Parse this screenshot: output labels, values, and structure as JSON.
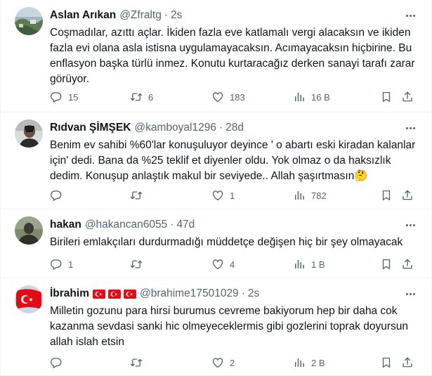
{
  "colors": {
    "text": "#0f1419",
    "muted": "#536471",
    "divider": "#eff3f4"
  },
  "tweets": [
    {
      "name": "Aslan Arıkan",
      "handle": "@Zfraltg",
      "sep": "·",
      "time": "2s",
      "text": "Coşmadılar, azıttı açlar. İkiden fazla eve katlamalı vergi alacaksın ve ikiden fazla evi olana asla istisna uygulamayacaksın. Acımayacaksın hiçbirine. Bu enflasyon başka türlü inmez. Konutu kurtaracağız derken sanayi tarafı zarar görüyor.",
      "replies": "15",
      "retweets": "6",
      "likes": "183",
      "views": "16 B"
    },
    {
      "name": "Rıdvan ŞİMŞEK",
      "handle": "@kamboyal1296",
      "sep": "·",
      "time": "28d",
      "text": "Benim ev sahibi %60'lar konuşuluyor deyince ' o abartı eski kiradan kalanlar için' dedi. Bana da %25 teklif et diyenler oldu. Yok olmaz o da haksızlık dedim. Konuşup anlaştık makul bir seviyede.. Allah şaşırtmasın🤔",
      "replies": "",
      "retweets": "",
      "likes": "1",
      "views": "782"
    },
    {
      "name": "hakan",
      "handle": "@hakancan6055",
      "sep": "·",
      "time": "47d",
      "text": "Birileri emlakçıları durdurmadığı müddetçe değişen hiç bir şey olmayacak",
      "replies": "1",
      "retweets": "",
      "likes": "4",
      "views": "1 B"
    },
    {
      "name": "İbrahim",
      "handle": "@brahime17501029",
      "sep": "·",
      "time": "2s",
      "text": "Milletin gozunu para hirsi burumus cevreme bakiyorum hep bir daha cok kazanma sevdasi sanki hic olmeyeceklermis gibi gozlerini toprak doyursun allah islah etsin",
      "replies": "",
      "retweets": "",
      "likes": "2",
      "views": "2 B",
      "flags": [
        "turkey-flag",
        "turkey-flag",
        "turkey-flag"
      ]
    }
  ]
}
